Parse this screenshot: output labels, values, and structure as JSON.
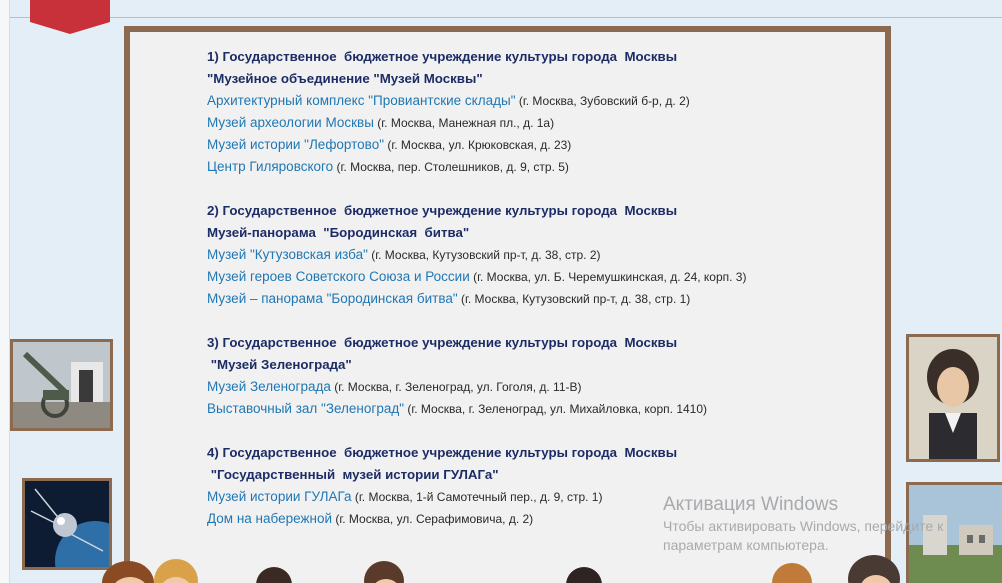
{
  "groups": [
    {
      "title_line1": "1) Государственное  бюджетное учреждение культуры города  Москвы",
      "title_line2": "\"Музейное объединение \"Музей Москвы\"",
      "items": [
        {
          "name": "Архитектурный  комплекс \"Провиантские  склады\"",
          "address": " (г. Москва, Зубовский б-р, д. 2)"
        },
        {
          "name": "Музей археологии Москвы",
          "address": " (г. Москва, Манежная пл., д. 1а)"
        },
        {
          "name": "Музей истории  \"Лефортово\"",
          "address": "  (г. Москва, ул. Крюковская, д. 23)"
        },
        {
          "name": "Центр  Гиляровского",
          "address": " (г. Москва, пер. Столешников, д. 9, стр. 5)"
        }
      ]
    },
    {
      "title_line1": "2) Государственное  бюджетное учреждение культуры города  Москвы",
      "title_line2": "Музей-панорама  \"Бородинская  битва\"",
      "items": [
        {
          "name": "Музей \"Кутузовская изба\"",
          "address": "  (г. Москва, Кутузовский пр-т, д. 38, стр. 2)"
        },
        {
          "name": "Музей героев Советского Союза и России",
          "address": " (г. Москва, ул. Б. Черемушкинская, д. 24, корп. 3)"
        },
        {
          "name": "Музей – панорама \"Бородинская  битва\"",
          "address": " (г. Москва, Кутузовский пр-т, д. 38, стр. 1)"
        }
      ]
    },
    {
      "title_line1": "3) Государственное  бюджетное учреждение культуры города  Москвы",
      "title_line2": " \"Музей Зеленограда\"",
      "items": [
        {
          "name": "Музей Зеленограда",
          "address": "  (г. Москва, г. Зеленоград, ул. Гоголя, д. 11-В)"
        },
        {
          "name": "Выставочный  зал \"Зеленоград\"",
          "address": "  (г. Москва, г. Зеленоград, ул. Михайловка, корп. 1410)"
        }
      ]
    },
    {
      "title_line1": "4) Государственное  бюджетное учреждение культуры города  Москвы",
      "title_line2": " \"Государственный  музей истории ГУЛАГа\"",
      "items": [
        {
          "name": "Музей истории ГУЛАГа",
          "address": " (г. Москва, 1-й Самотечный пер., д. 9, стр. 1)"
        },
        {
          "name": "Дом на набережной",
          "address": "  (г. Москва, ул. Серафимовича, д. 2)"
        }
      ]
    }
  ],
  "watermark": {
    "title": "Активация Windows",
    "subtitle": "Чтобы активировать Windows, перейдите к параметрам компьютера."
  },
  "colors": {
    "frame": "#8b6a4f",
    "heading": "#1c2d66",
    "link": "#1f77b4",
    "ribbon": "#c8313a"
  }
}
